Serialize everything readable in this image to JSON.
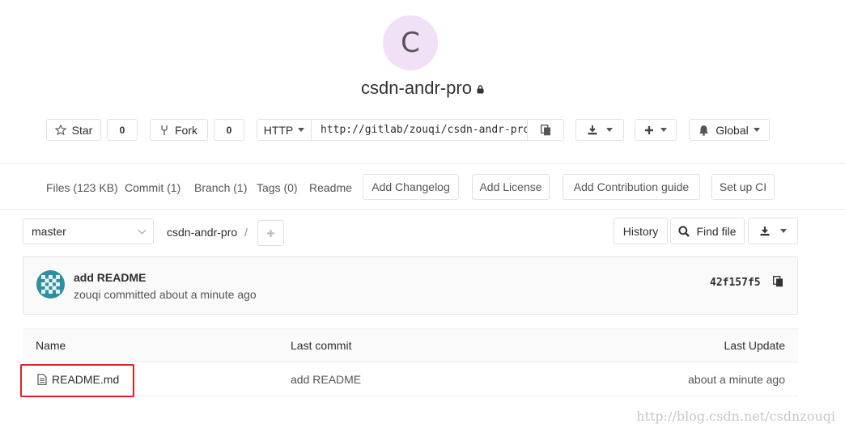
{
  "project": {
    "avatar_letter": "C",
    "name": "csdn-andr-pro"
  },
  "actions": {
    "star_label": "Star",
    "star_count": "0",
    "fork_label": "Fork",
    "fork_count": "0",
    "protocol_label": "HTTP",
    "clone_url": "http://gitlab/zouqi/csdn-andr-pro",
    "notification_label": "Global"
  },
  "stats": {
    "files": "Files (123 KB)",
    "commit": "Commit (1)",
    "branch": "Branch (1)",
    "tags": "Tags (0)",
    "readme": "Readme",
    "add_changelog": "Add Changelog",
    "add_license": "Add License",
    "add_contribution": "Add Contribution guide",
    "setup_ci": "Set up CI"
  },
  "tree": {
    "branch": "master",
    "path": "csdn-andr-pro",
    "separator": "/",
    "history_label": "History",
    "find_file_label": "Find file"
  },
  "last_commit": {
    "title": "add README",
    "author_line": "zouqi committed about a minute ago",
    "sha": "42f157f5"
  },
  "files_table": {
    "headers": {
      "name": "Name",
      "last_commit": "Last commit",
      "last_update": "Last Update"
    },
    "rows": [
      {
        "name": "README.md",
        "last_commit": "add README",
        "last_update": "about a minute ago"
      }
    ]
  },
  "watermark": "http://blog.csdn.net/csdnzouqi",
  "colors": {
    "avatar_bg": "#f0e1f6",
    "highlight": "#e02020",
    "panel_bg": "#fafafa"
  }
}
